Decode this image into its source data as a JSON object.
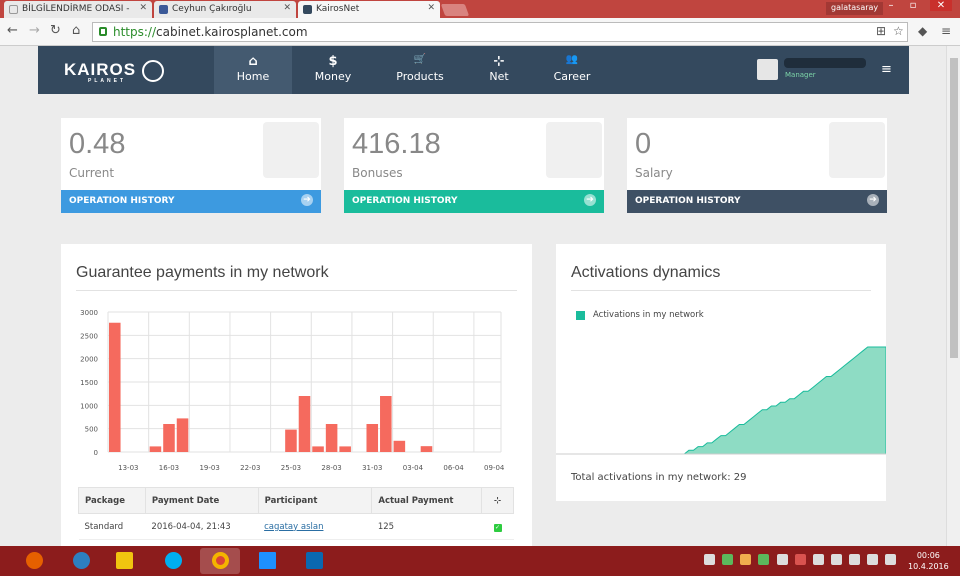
{
  "browser": {
    "tabs": [
      {
        "label": "BİLGİLENDİRME ODASI - ",
        "favicon_color": "#e8e8e8"
      },
      {
        "label": "Ceyhun Çakıroğlu",
        "favicon_color": "#3b5998"
      },
      {
        "label": "KairosNet",
        "favicon_color": "#34495e"
      }
    ],
    "profile_badge": "galatasaray",
    "url_scheme": "https://",
    "url_rest": "cabinet.kairosplanet.com"
  },
  "nav": {
    "logo_text": "KAIROS",
    "logo_sub": "PLANET",
    "items": [
      {
        "label": "Home",
        "icon": "home-icon",
        "glyph": "⌂"
      },
      {
        "label": "Money",
        "icon": "dollar-icon",
        "glyph": "$"
      },
      {
        "label": "Products",
        "icon": "cart-icon",
        "glyph": "🛒"
      },
      {
        "label": "Net",
        "icon": "sitemap-icon",
        "glyph": "⊹"
      },
      {
        "label": "Career",
        "icon": "users-icon",
        "glyph": "👥"
      }
    ],
    "user_role": "Manager",
    "menu_glyph": "≡"
  },
  "stats": [
    {
      "value": "0.48",
      "label": "Current",
      "action": "OPERATION HISTORY",
      "color": "#3498db"
    },
    {
      "value": "416.18",
      "label": "Bonuses",
      "action": "OPERATION HISTORY",
      "color": "#1abc9c"
    },
    {
      "value": "0",
      "label": "Salary",
      "action": "OPERATION HISTORY",
      "color": "#34495e"
    }
  ],
  "guarantee": {
    "title": "Guarantee payments in my network",
    "table": {
      "headers": [
        "Package",
        "Payment Date",
        "Participant",
        "Actual Payment"
      ],
      "rows": [
        {
          "package": "Standard",
          "date": "2016-04-04, 21:43",
          "participant": "cagatay aslan",
          "payment": "125"
        }
      ]
    }
  },
  "activations": {
    "title": "Activations dynamics",
    "legend": "Activations in my network",
    "total": "Total activations in my network: 29"
  },
  "chart_data": [
    {
      "type": "bar",
      "title": "Guarantee payments in my network",
      "xlabel": "",
      "ylabel": "",
      "ylim": [
        0,
        3000
      ],
      "yticks": [
        0,
        500,
        1000,
        1500,
        2000,
        2500,
        3000
      ],
      "xticks": [
        "13-03",
        "16-03",
        "19-03",
        "22-03",
        "25-03",
        "28-03",
        "31-03",
        "03-04",
        "06-04",
        "09-04"
      ],
      "x": [
        "12-03",
        "13-03",
        "14-03",
        "15-03",
        "16-03",
        "17-03",
        "18-03",
        "19-03",
        "20-03",
        "21-03",
        "22-03",
        "23-03",
        "24-03",
        "25-03",
        "26-03",
        "27-03",
        "28-03",
        "29-03",
        "30-03",
        "31-03",
        "01-04",
        "02-04",
        "03-04",
        "04-04",
        "05-04",
        "06-04",
        "07-04",
        "08-04",
        "09-04"
      ],
      "values": [
        2770,
        0,
        0,
        120,
        600,
        720,
        0,
        0,
        0,
        0,
        0,
        0,
        0,
        480,
        1200,
        120,
        600,
        120,
        0,
        600,
        1200,
        240,
        0,
        125,
        0,
        0,
        0,
        0,
        0
      ],
      "color": "#f56a5e",
      "grid": true
    },
    {
      "type": "area",
      "title": "Activations dynamics",
      "series": [
        {
          "name": "Activations in my network",
          "color": "#1abc9c"
        }
      ],
      "values": [
        0,
        0,
        0,
        0,
        0,
        0,
        0,
        0,
        0,
        0,
        0,
        0,
        0,
        0,
        0,
        0,
        0,
        0,
        0,
        0,
        0,
        0,
        0,
        0,
        0,
        0,
        0,
        0,
        0,
        1,
        1,
        2,
        2,
        3,
        3,
        4,
        5,
        5,
        6,
        7,
        8,
        8,
        9,
        10,
        11,
        12,
        12,
        13,
        13,
        14,
        14,
        15,
        15,
        16,
        17,
        17,
        18,
        19,
        20,
        21,
        21,
        22,
        23,
        24,
        25,
        26,
        27,
        28,
        29,
        29,
        29,
        29,
        29
      ],
      "ymax": 29,
      "legend_position": "top-left",
      "grid": false
    }
  ],
  "taskbar": {
    "time": "00:06",
    "date": "10.4.2016"
  }
}
